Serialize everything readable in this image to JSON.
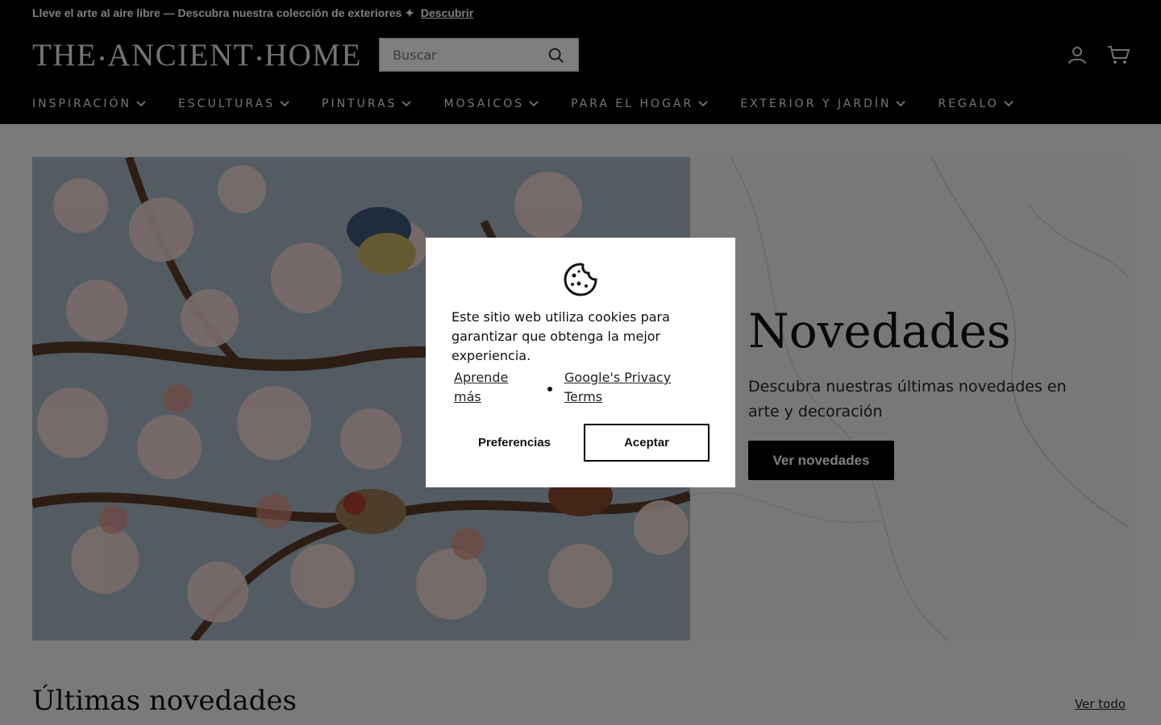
{
  "announcement": {
    "text": "Lleve el arte al aire libre — Descubra nuestra colección de exteriores ✦",
    "link": "Descubrir"
  },
  "header": {
    "logo": {
      "word1": "THE",
      "word2": "ANCIENT",
      "word3": "HOME"
    },
    "search": {
      "placeholder": "Buscar"
    },
    "icons": [
      "search-icon",
      "account-icon",
      "cart-icon"
    ]
  },
  "nav": {
    "items": [
      {
        "label": "INSPIRACIÓN"
      },
      {
        "label": "ESCULTURAS"
      },
      {
        "label": "PINTURAS"
      },
      {
        "label": "MOSAICOS"
      },
      {
        "label": "PARA EL HOGAR"
      },
      {
        "label": "EXTERIOR Y JARDÍN"
      },
      {
        "label": "REGALO"
      }
    ]
  },
  "hero": {
    "title": "Novedades",
    "subtitle": "Descubra nuestras últimas novedades en arte y decoración",
    "button": "Ver novedades"
  },
  "section": {
    "title": "Últimas novedades",
    "link": "Ver todo"
  },
  "cookie_modal": {
    "icon": "cookie-icon",
    "text": "Este sitio web utiliza cookies para garantizar que obtenga la mejor experiencia.",
    "learn_more": "Aprende más",
    "privacy": "Google's Privacy Terms",
    "preferences": "Preferencias",
    "accept": "Aceptar"
  },
  "colors": {
    "header_bg": "#000000",
    "overlay": "rgba(0,0,0,0.5)",
    "button_bg": "#000000"
  }
}
